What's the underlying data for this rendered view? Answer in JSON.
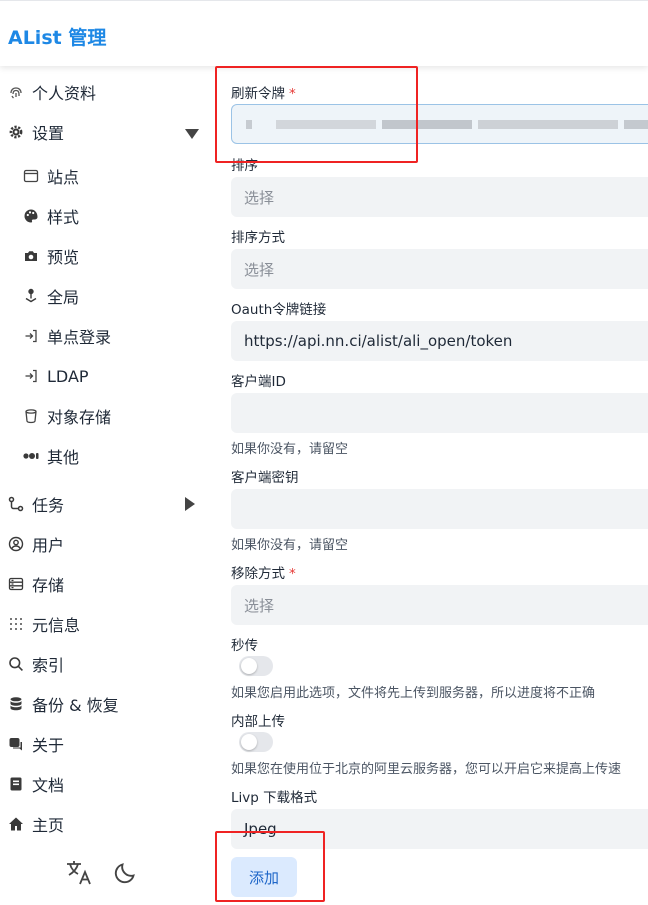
{
  "header": {
    "title": "AList 管理"
  },
  "sidebar": {
    "items": [
      {
        "label": "个人资料",
        "icon": "fingerprint-icon"
      },
      {
        "label": "设置",
        "icon": "gear-icon",
        "expanded": true
      },
      {
        "label": "站点",
        "icon": "window-icon"
      },
      {
        "label": "样式",
        "icon": "palette-icon"
      },
      {
        "label": "预览",
        "icon": "camera-icon"
      },
      {
        "label": "全局",
        "icon": "joystick-icon"
      },
      {
        "label": "单点登录",
        "icon": "login-icon"
      },
      {
        "label": "LDAP",
        "icon": "login-icon"
      },
      {
        "label": "对象存储",
        "icon": "bucket-icon"
      },
      {
        "label": "其他",
        "icon": "dots-icon"
      },
      {
        "label": "任务",
        "icon": "tasks-icon",
        "expanded": false
      },
      {
        "label": "用户",
        "icon": "user-icon"
      },
      {
        "label": "存储",
        "icon": "database-icon"
      },
      {
        "label": "元信息",
        "icon": "meta-icon"
      },
      {
        "label": "索引",
        "icon": "search-icon"
      },
      {
        "label": "备份 & 恢复",
        "icon": "backup-icon"
      },
      {
        "label": "关于",
        "icon": "chat-icon"
      },
      {
        "label": "文档",
        "icon": "book-icon"
      },
      {
        "label": "主页",
        "icon": "home-icon"
      }
    ]
  },
  "form": {
    "refresh_token_label": "刷新令牌",
    "required_mark": "*",
    "order_by_label": "排序",
    "order_by_placeholder": "选择",
    "order_direction_label": "排序方式",
    "order_direction_placeholder": "选择",
    "oauth_url_label": "Oauth令牌链接",
    "oauth_url_value": "https://api.nn.ci/alist/ali_open/token",
    "client_id_label": "客户端ID",
    "client_id_hint": "如果你没有，请留空",
    "client_secret_label": "客户端密钥",
    "client_secret_hint": "如果你没有，请留空",
    "remove_way_label": "移除方式",
    "remove_way_placeholder": "选择",
    "rapid_upload_label": "秒传",
    "rapid_upload_hint": "如果您启用此选项，文件将先上传到服务器，所以进度将不正确",
    "rapid_upload_on": false,
    "internal_upload_label": "内部上传",
    "internal_upload_hint": "如果您在使用位于北京的阿里云服务器，您可以开启它来提高上传速",
    "internal_upload_on": false,
    "livp_format_label": "Livp 下载格式",
    "livp_format_value": "Jpeg",
    "add_button": "添加"
  },
  "colors": {
    "brand": "#1e88e5",
    "required": "#e53935",
    "annotation": "#ef2323",
    "button_bg": "#dbeafe"
  }
}
